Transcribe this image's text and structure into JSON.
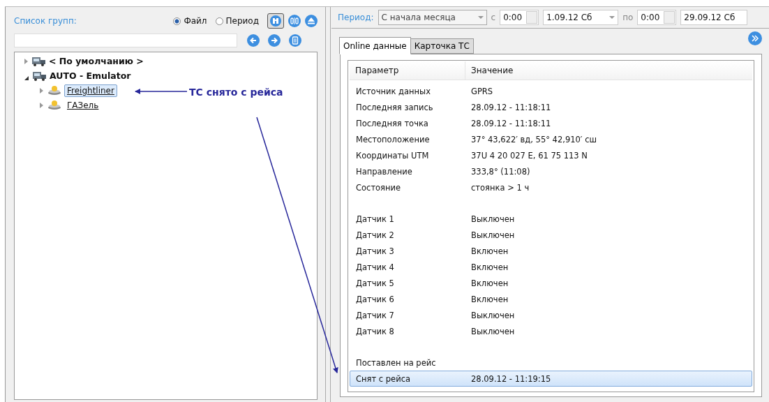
{
  "groups_panel": {
    "title": "Список групп:",
    "source_options": [
      {
        "label": "Файл",
        "selected": true
      },
      {
        "label": "Период",
        "selected": false
      }
    ],
    "tree": [
      {
        "label": "< По умолчанию >",
        "kind": "group",
        "expanded": false,
        "selected": false
      },
      {
        "label": "AUTO - Emulator",
        "kind": "group",
        "expanded": true,
        "selected": false,
        "children": [
          {
            "label": "Freightliner",
            "kind": "vehicle",
            "expanded": false,
            "selected": true
          },
          {
            "label": "ГАЗель",
            "kind": "vehicle",
            "expanded": false,
            "selected": false
          }
        ]
      }
    ]
  },
  "period_bar": {
    "label": "Период:",
    "preset": "С начала месяца",
    "from_label": "с",
    "from_time": "0:00",
    "from_date": "1.09.12 Сб",
    "to_label": "по",
    "to_time": "0:00",
    "to_date": "29.09.12 Сб"
  },
  "tabs": [
    {
      "label": "Online данные",
      "selected": true
    },
    {
      "label": "Карточка ТС",
      "selected": false
    }
  ],
  "table": {
    "columns": [
      "Параметр",
      "Значение"
    ],
    "groups": [
      [
        {
          "param": "Источник данных",
          "value": "GPRS",
          "selected": false
        },
        {
          "param": "Последняя запись",
          "value": "28.09.12 - 11:18:11",
          "selected": false
        },
        {
          "param": "Последняя точка",
          "value": "28.09.12 - 11:18:11",
          "selected": false
        },
        {
          "param": "Местоположение",
          "value": "37° 43,622′ вд, 55° 42,910′ сш",
          "selected": false
        },
        {
          "param": "Координаты UTM",
          "value": "37U 4 20 027 E, 61 75 113 N",
          "selected": false
        },
        {
          "param": "Направление",
          "value": "333,8° (11:08)",
          "selected": false
        },
        {
          "param": "Состояние",
          "value": "стоянка > 1 ч",
          "selected": false
        }
      ],
      [
        {
          "param": "Датчик 1",
          "value": "Выключен",
          "selected": false
        },
        {
          "param": "Датчик 2",
          "value": "Выключен",
          "selected": false
        },
        {
          "param": "Датчик 3",
          "value": "Включен",
          "selected": false
        },
        {
          "param": "Датчик 4",
          "value": "Включен",
          "selected": false
        },
        {
          "param": "Датчик 5",
          "value": "Включен",
          "selected": false
        },
        {
          "param": "Датчик 6",
          "value": "Включен",
          "selected": false
        },
        {
          "param": "Датчик 7",
          "value": "Выключен",
          "selected": false
        },
        {
          "param": "Датчик 8",
          "value": "Выключен",
          "selected": false
        }
      ],
      [
        {
          "param": "Поставлен на рейс",
          "selected": false
        },
        {
          "param": "Снят с рейса",
          "value": "28.09.12 - 11:19:15",
          "selected": true
        }
      ]
    ]
  },
  "annotation": {
    "label": "ТС снято с рейса"
  }
}
